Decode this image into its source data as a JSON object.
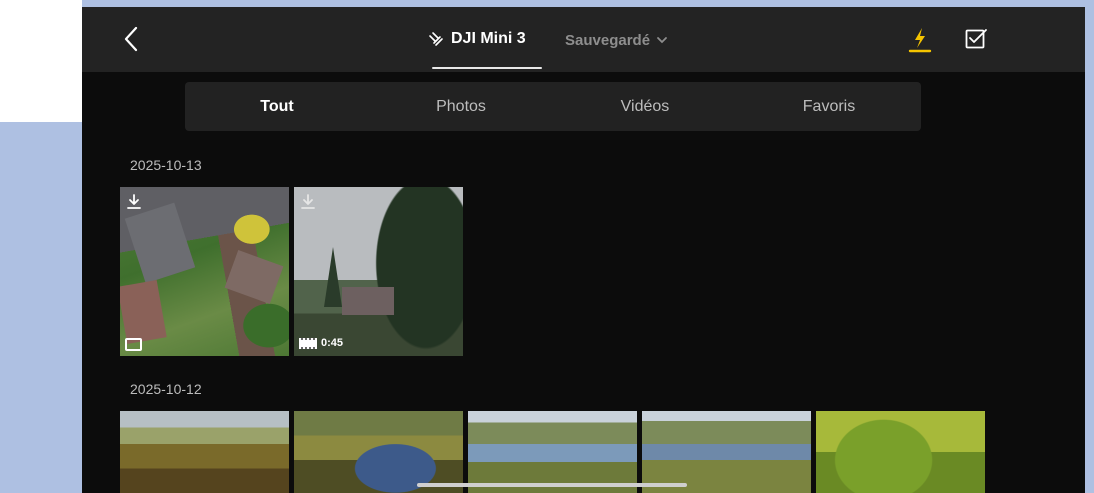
{
  "header": {
    "back_icon": "chevron-left-icon",
    "drone_icon": "drone-icon",
    "title": "DJI Mini 3",
    "saved_label": "Sauvegardé",
    "saved_dropdown_icon": "chevron-down-icon",
    "flash_icon": "quick-transfer-icon",
    "flash_color": "#f5c400",
    "select_icon": "select-checkbox-icon"
  },
  "tabs": [
    {
      "label": "Tout",
      "active": true
    },
    {
      "label": "Photos",
      "active": false
    },
    {
      "label": "Vidéos",
      "active": false
    },
    {
      "label": "Favoris",
      "active": false
    }
  ],
  "groups": [
    {
      "date": "2025-10-13",
      "items": [
        {
          "type": "photo",
          "download_icon": "download-icon",
          "badge_icon": "photo-icon"
        },
        {
          "type": "video",
          "download_icon": "download-icon",
          "badge_icon": "film-icon",
          "duration": "0:45"
        }
      ]
    },
    {
      "date": "2025-10-12",
      "items": [
        {
          "type": "photo"
        },
        {
          "type": "photo"
        },
        {
          "type": "photo"
        },
        {
          "type": "photo"
        },
        {
          "type": "photo"
        }
      ]
    }
  ]
}
